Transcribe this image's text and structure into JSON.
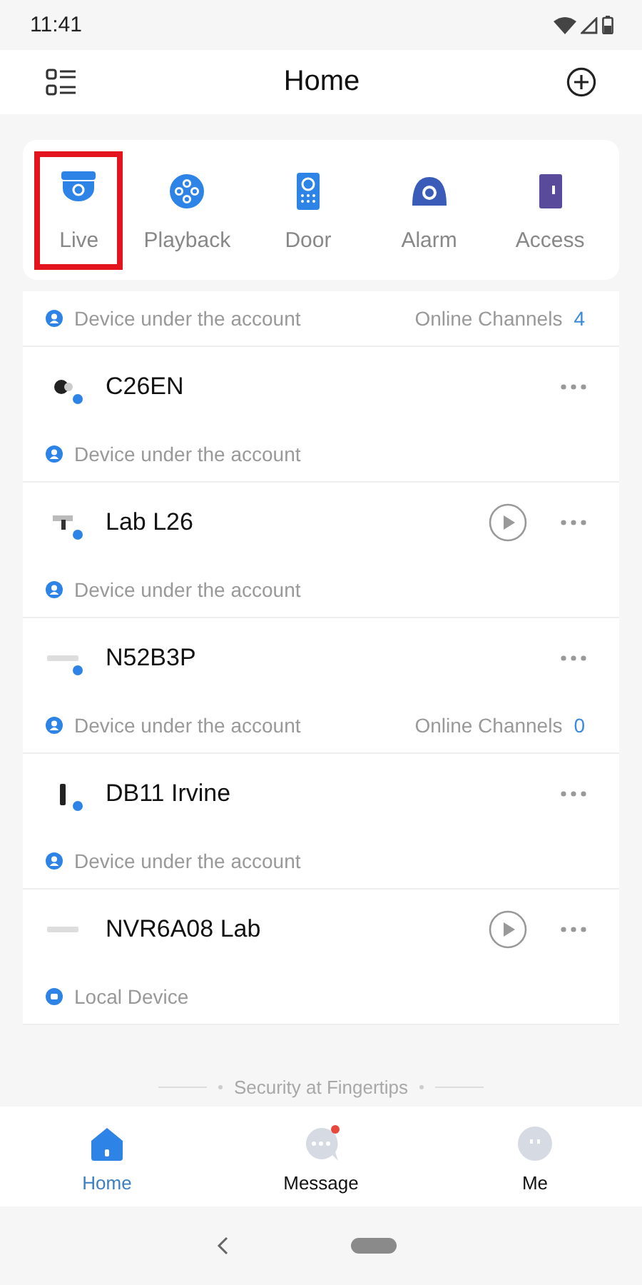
{
  "status_bar": {
    "time": "11:41"
  },
  "header": {
    "title": "Home"
  },
  "shortcuts": [
    {
      "kind": "live",
      "label": "Live",
      "highlighted": true
    },
    {
      "kind": "playback",
      "label": "Playback",
      "highlighted": false
    },
    {
      "kind": "door",
      "label": "Door",
      "highlighted": false
    },
    {
      "kind": "alarm",
      "label": "Alarm",
      "highlighted": false
    },
    {
      "kind": "access",
      "label": "Access",
      "highlighted": false
    }
  ],
  "rows": [
    {
      "kind": "info",
      "source": "Device under the account",
      "source_icon": {
        "kind": "account"
      },
      "channels_label": "Online Channels",
      "channels": "4"
    },
    {
      "kind": "device",
      "name": "C26EN",
      "thumbnail": {
        "kind": "camera"
      },
      "online": true,
      "playable": false
    },
    {
      "kind": "info",
      "source": "Device under the account",
      "source_icon": {
        "kind": "account"
      }
    },
    {
      "kind": "device",
      "name": "Lab L26",
      "thumbnail": {
        "kind": "bullet"
      },
      "online": true,
      "playable": true
    },
    {
      "kind": "info",
      "source": "Device under the account",
      "source_icon": {
        "kind": "account"
      }
    },
    {
      "kind": "device",
      "name": "N52B3P",
      "thumbnail": {
        "kind": "recorder"
      },
      "online": true,
      "playable": false
    },
    {
      "kind": "info",
      "source": "Device under the account",
      "source_icon": {
        "kind": "account"
      },
      "channels_label": "Online Channels",
      "channels": "0"
    },
    {
      "kind": "device",
      "name": "DB11 Irvine",
      "thumbnail": {
        "kind": "doorbell"
      },
      "online": true,
      "playable": false
    },
    {
      "kind": "info",
      "source": "Device under the account",
      "source_icon": {
        "kind": "account"
      }
    },
    {
      "kind": "device",
      "name": "NVR6A08 Lab",
      "thumbnail": {
        "kind": "recorder"
      },
      "online": false,
      "playable": true
    },
    {
      "kind": "info",
      "source": "Local Device",
      "source_icon": {
        "kind": "local"
      }
    }
  ],
  "slogan": "Security at Fingertips",
  "tabs": [
    {
      "kind": "home",
      "label": "Home",
      "selected": true,
      "badge": false
    },
    {
      "kind": "message",
      "label": "Message",
      "selected": false,
      "badge": true
    },
    {
      "kind": "me",
      "label": "Me",
      "selected": false,
      "badge": false
    }
  ]
}
